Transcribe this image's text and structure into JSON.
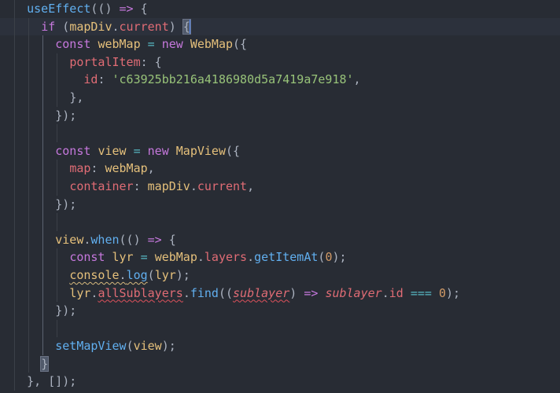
{
  "editor": {
    "active_line": 2,
    "lines": [
      {
        "indent": 4,
        "tokens": [
          [
            "useEffect",
            "fn"
          ],
          [
            "(() ",
            "punc"
          ],
          [
            "=>",
            "kw"
          ],
          [
            " {",
            "punc"
          ]
        ]
      },
      {
        "indent": 6,
        "tokens": [
          [
            "if",
            "kw"
          ],
          [
            " (",
            "punc"
          ],
          [
            "mapDiv",
            "var"
          ],
          [
            ".",
            "punc"
          ],
          [
            "current",
            "prop"
          ],
          [
            ") ",
            "punc"
          ],
          [
            "{",
            "punc",
            "match"
          ]
        ],
        "cursor": true
      },
      {
        "indent": 8,
        "tokens": [
          [
            "const",
            "kw"
          ],
          [
            " ",
            "punc"
          ],
          [
            "webMap",
            "var"
          ],
          [
            " ",
            "punc"
          ],
          [
            "=",
            "op"
          ],
          [
            " ",
            "punc"
          ],
          [
            "new",
            "kw"
          ],
          [
            " ",
            "punc"
          ],
          [
            "WebMap",
            "cls"
          ],
          [
            "({",
            "punc"
          ]
        ]
      },
      {
        "indent": 10,
        "tokens": [
          [
            "portalItem",
            "prop"
          ],
          [
            ": {",
            "punc"
          ]
        ]
      },
      {
        "indent": 12,
        "tokens": [
          [
            "id",
            "prop"
          ],
          [
            ": ",
            "punc"
          ],
          [
            "'c63925bb216a4186980d5a7419a7e918'",
            "str"
          ],
          [
            ",",
            "punc"
          ]
        ]
      },
      {
        "indent": 10,
        "tokens": [
          [
            "},",
            "punc"
          ]
        ]
      },
      {
        "indent": 8,
        "tokens": [
          [
            "});",
            "punc"
          ]
        ]
      },
      {
        "indent": 0,
        "tokens": []
      },
      {
        "indent": 8,
        "tokens": [
          [
            "const",
            "kw"
          ],
          [
            " ",
            "punc"
          ],
          [
            "view",
            "var"
          ],
          [
            " ",
            "punc"
          ],
          [
            "=",
            "op"
          ],
          [
            " ",
            "punc"
          ],
          [
            "new",
            "kw"
          ],
          [
            " ",
            "punc"
          ],
          [
            "MapView",
            "cls"
          ],
          [
            "({",
            "punc"
          ]
        ]
      },
      {
        "indent": 10,
        "tokens": [
          [
            "map",
            "prop"
          ],
          [
            ": ",
            "punc"
          ],
          [
            "webMap",
            "var"
          ],
          [
            ",",
            "punc"
          ]
        ]
      },
      {
        "indent": 10,
        "tokens": [
          [
            "container",
            "prop"
          ],
          [
            ": ",
            "punc"
          ],
          [
            "mapDiv",
            "var"
          ],
          [
            ".",
            "punc"
          ],
          [
            "current",
            "prop"
          ],
          [
            ",",
            "punc"
          ]
        ]
      },
      {
        "indent": 8,
        "tokens": [
          [
            "});",
            "punc"
          ]
        ]
      },
      {
        "indent": 0,
        "tokens": []
      },
      {
        "indent": 8,
        "tokens": [
          [
            "view",
            "var"
          ],
          [
            ".",
            "punc"
          ],
          [
            "when",
            "fn"
          ],
          [
            "(() ",
            "punc"
          ],
          [
            "=>",
            "kw"
          ],
          [
            " {",
            "punc"
          ]
        ]
      },
      {
        "indent": 10,
        "tokens": [
          [
            "const",
            "kw"
          ],
          [
            " ",
            "punc"
          ],
          [
            "lyr",
            "var"
          ],
          [
            " ",
            "punc"
          ],
          [
            "=",
            "op"
          ],
          [
            " ",
            "punc"
          ],
          [
            "webMap",
            "var"
          ],
          [
            ".",
            "punc"
          ],
          [
            "layers",
            "prop"
          ],
          [
            ".",
            "punc"
          ],
          [
            "getItemAt",
            "fn"
          ],
          [
            "(",
            "punc"
          ],
          [
            "0",
            "num"
          ],
          [
            ");",
            "punc"
          ]
        ]
      },
      {
        "indent": 10,
        "tokens": [
          [
            "console",
            "var",
            "warn"
          ],
          [
            ".",
            "punc",
            "warn"
          ],
          [
            "log",
            "fn",
            "warn"
          ],
          [
            "(",
            "punc"
          ],
          [
            "lyr",
            "var"
          ],
          [
            ");",
            "punc"
          ]
        ]
      },
      {
        "indent": 10,
        "tokens": [
          [
            "lyr",
            "var"
          ],
          [
            ".",
            "punc"
          ],
          [
            "allSublayers",
            "prop",
            "err"
          ],
          [
            ".",
            "punc"
          ],
          [
            "find",
            "fn"
          ],
          [
            "((",
            "punc"
          ],
          [
            "sublayer",
            "param",
            "err"
          ],
          [
            ") ",
            "punc"
          ],
          [
            "=>",
            "kw"
          ],
          [
            " ",
            "punc"
          ],
          [
            "sublayer",
            "param"
          ],
          [
            ".",
            "punc"
          ],
          [
            "id",
            "prop"
          ],
          [
            " ",
            "punc"
          ],
          [
            "===",
            "op"
          ],
          [
            " ",
            "punc"
          ],
          [
            "0",
            "num"
          ],
          [
            ");",
            "punc"
          ]
        ]
      },
      {
        "indent": 8,
        "tokens": [
          [
            "});",
            "punc"
          ]
        ]
      },
      {
        "indent": 0,
        "tokens": []
      },
      {
        "indent": 8,
        "tokens": [
          [
            "setMapView",
            "fn"
          ],
          [
            "(",
            "punc"
          ],
          [
            "view",
            "var"
          ],
          [
            ");",
            "punc"
          ]
        ]
      },
      {
        "indent": 6,
        "tokens": [
          [
            "}",
            "punc",
            "match"
          ]
        ]
      },
      {
        "indent": 4,
        "tokens": [
          [
            "}, []);",
            "punc"
          ]
        ]
      }
    ]
  }
}
